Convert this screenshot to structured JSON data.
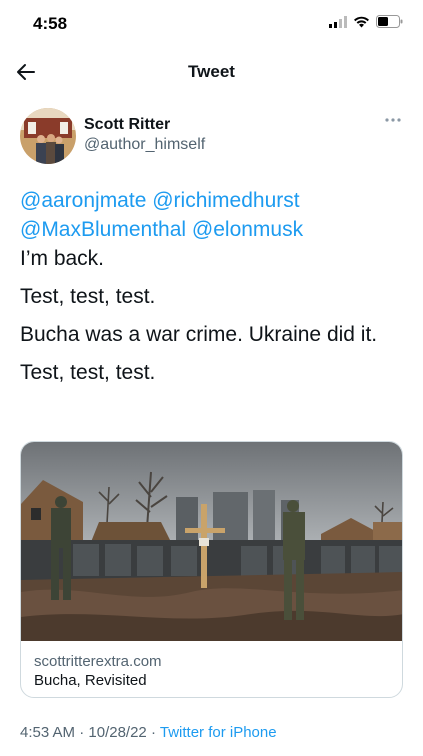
{
  "status_bar": {
    "time": "4:58"
  },
  "nav": {
    "title": "Tweet"
  },
  "author": {
    "name": "Scott Ritter",
    "handle": "@author_himself"
  },
  "tweet": {
    "mentions_line1": [
      "@aaronjmate",
      "@richimedhurst"
    ],
    "mentions_line2": [
      "@MaxBlumenthal",
      "@elonmusk"
    ],
    "paragraphs": [
      "I’m back.",
      "Test, test, test.",
      "Bucha was a war crime. Ukraine did it.",
      "Test, test, test."
    ]
  },
  "link_card": {
    "domain": "scottritterextra.com",
    "title": "Bucha, Revisited"
  },
  "meta": {
    "time": "4:53 AM",
    "separator": "·",
    "date": "10/28/22",
    "source": "Twitter for iPhone"
  },
  "colors": {
    "accent": "#1d9bf0",
    "text": "#0f1419",
    "muted": "#536471",
    "border": "#cfd9de"
  }
}
